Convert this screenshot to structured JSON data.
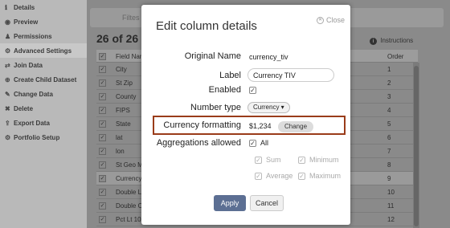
{
  "sidebar": {
    "items": [
      {
        "label": "Details",
        "icon": "info-icon",
        "glyph": "ℹ"
      },
      {
        "label": "Preview",
        "icon": "eye-icon",
        "glyph": "◉"
      },
      {
        "label": "Permissions",
        "icon": "people-icon",
        "glyph": "♟"
      },
      {
        "label": "Advanced Settings",
        "icon": "gear-icon",
        "glyph": "⚙"
      },
      {
        "label": "Join Data",
        "icon": "join-icon",
        "glyph": "⇄"
      },
      {
        "label": "Create Child Dataset",
        "icon": "child-dataset-icon",
        "glyph": "⊕"
      },
      {
        "label": "Change Data",
        "icon": "change-icon",
        "glyph": "✎"
      },
      {
        "label": "Delete",
        "icon": "delete-icon",
        "glyph": "✖"
      },
      {
        "label": "Export Data",
        "icon": "export-icon",
        "glyph": "⇪"
      },
      {
        "label": "Portfolio Setup",
        "icon": "portfolio-icon",
        "glyph": "⚙"
      }
    ]
  },
  "background": {
    "filter_tab": "Filtes",
    "heading": "26 of 26 fi",
    "instructions": "Instructions",
    "column_field": "Field Nam",
    "column_order": "Order",
    "rows": [
      {
        "name": "City",
        "order": "1"
      },
      {
        "name": "St Zip",
        "order": "2"
      },
      {
        "name": "County",
        "order": "3"
      },
      {
        "name": "FIPS",
        "order": "4"
      },
      {
        "name": "State",
        "order": "5"
      },
      {
        "name": "lat",
        "order": "6"
      },
      {
        "name": "lon",
        "order": "7"
      },
      {
        "name": "St Geo M",
        "order": "8"
      },
      {
        "name": "Currency",
        "order": "9"
      },
      {
        "name": "Double L",
        "order": "10"
      },
      {
        "name": "Double C",
        "order": "11"
      },
      {
        "name": "Pct Lt 10",
        "order": "12"
      }
    ]
  },
  "modal": {
    "title": "Edit column details",
    "close_label": "Close",
    "original_name_label": "Original Name",
    "original_name_value": "currency_tiv",
    "label_label": "Label",
    "label_value": "Currency TIV",
    "enabled_label": "Enabled",
    "number_type_label": "Number type",
    "number_type_value": "Currency ▾",
    "currency_formatting_label": "Currency formatting",
    "currency_formatting_value": "$1,234",
    "change_label": "Change",
    "aggregations_label": "Aggregations allowed",
    "all_label": "All",
    "sum_label": "Sum",
    "minimum_label": "Minimum",
    "average_label": "Average",
    "maximum_label": "Maximum",
    "apply_label": "Apply",
    "cancel_label": "Cancel",
    "check_glyph": "✓"
  },
  "colors": {
    "highlight_border": "#9a3c1a",
    "apply_button": "#5c6f93"
  }
}
